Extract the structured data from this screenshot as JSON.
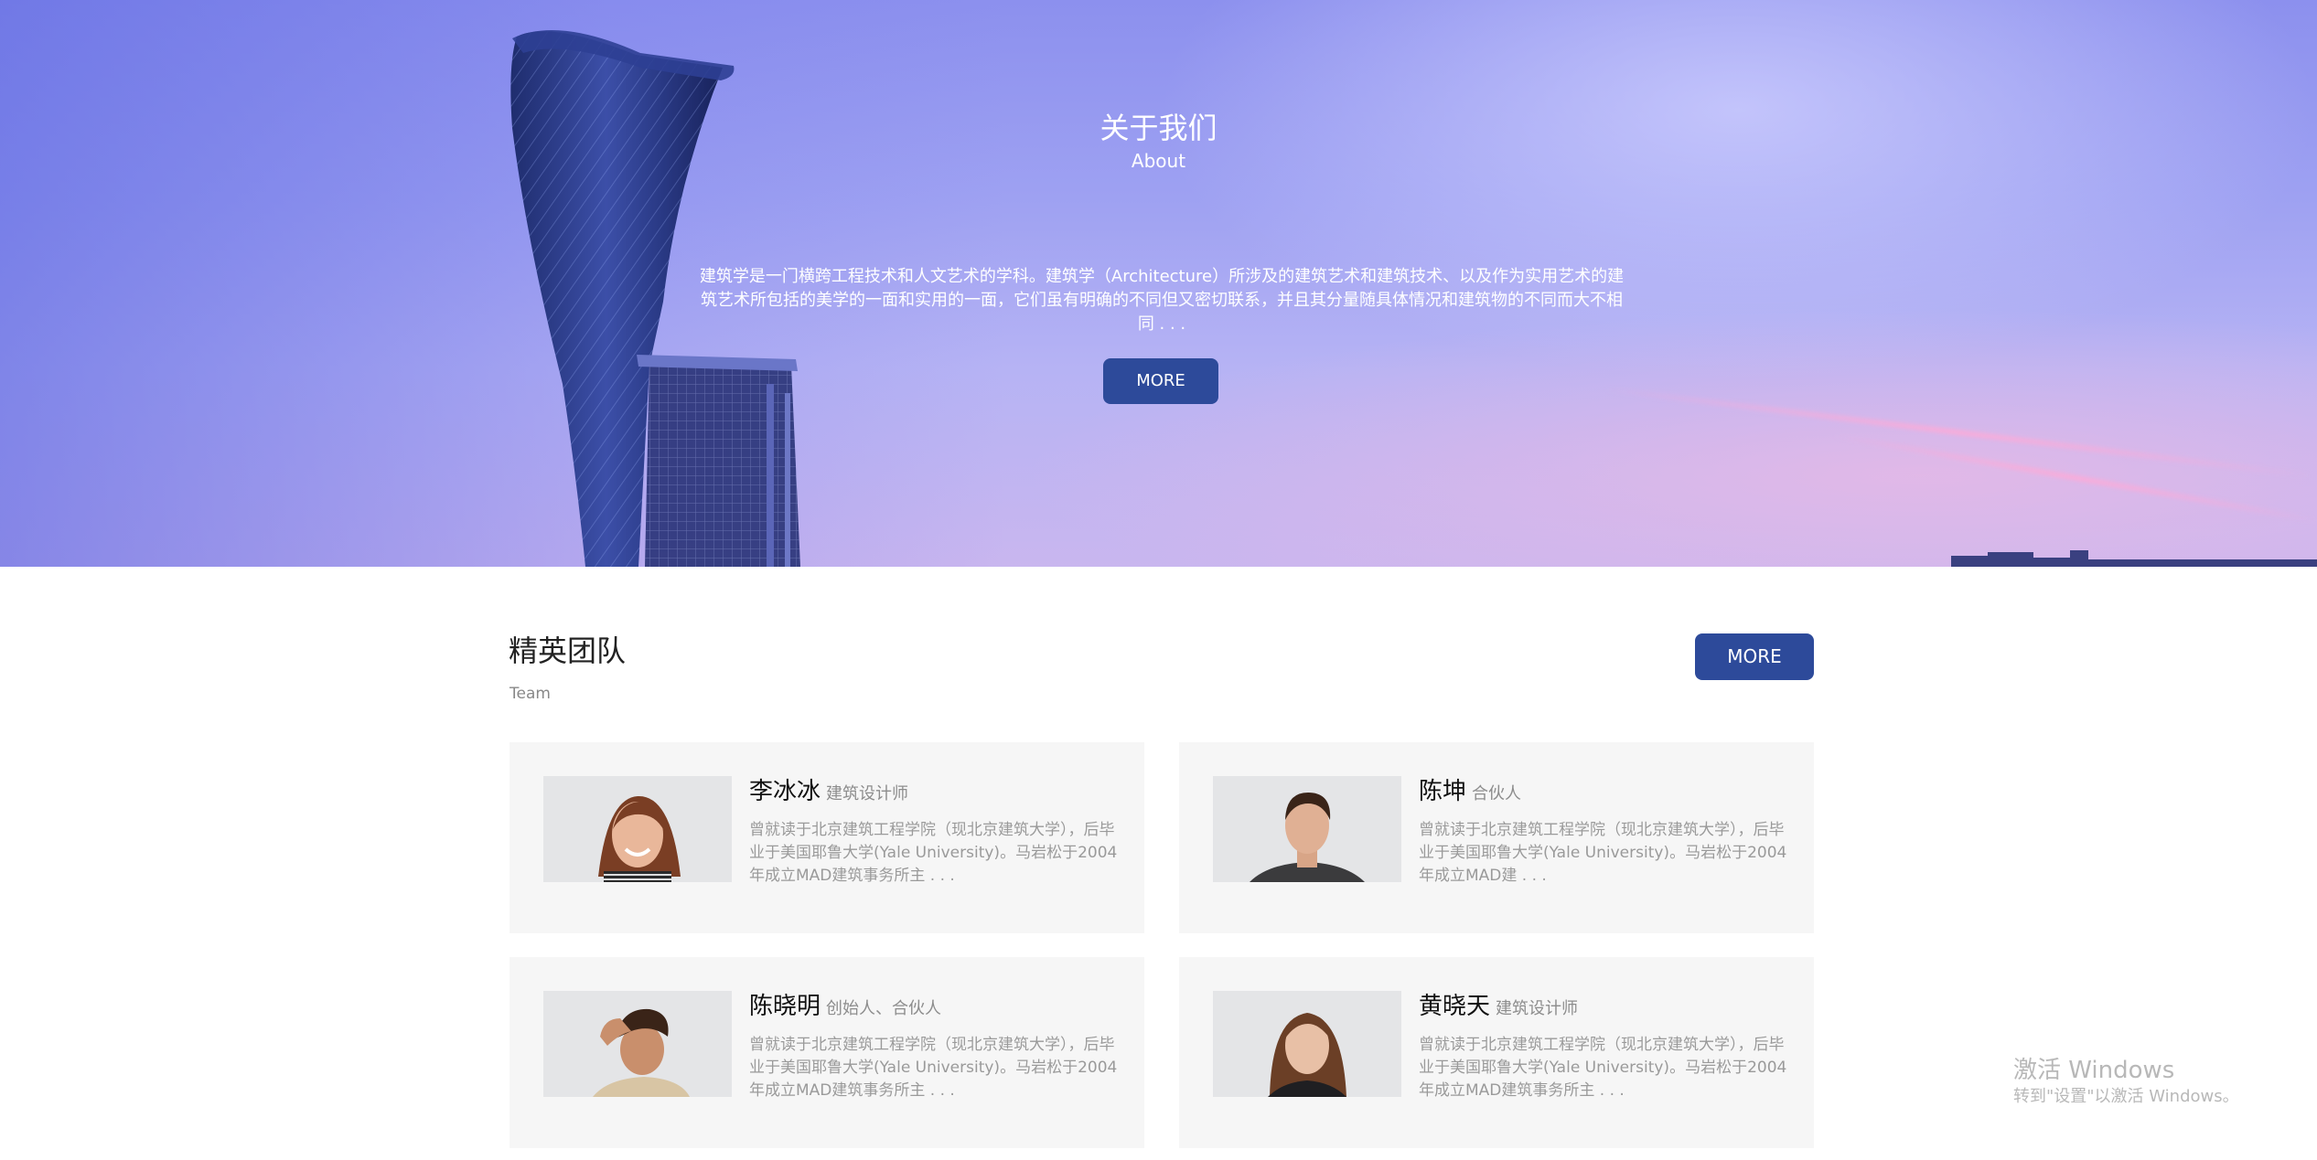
{
  "hero": {
    "title": "关于我们",
    "subtitle": "About",
    "description": "建筑学是一门横跨工程技术和人文艺术的学科。建筑学（Architecture）所涉及的建筑艺术和建筑技术、以及作为实用艺术的建筑艺术所包括的美学的一面和实用的一面，它们虽有明确的不同但又密切联系，并且其分量随具体情况和建筑物的不同而大不相同 . . .",
    "more_label": "MORE"
  },
  "team": {
    "title": "精英团队",
    "subtitle": "Team",
    "more_label": "MORE",
    "members": [
      {
        "name": "李冰冰",
        "role": "建筑设计师",
        "bio": "曾就读于北京建筑工程学院（现北京建筑大学），后毕业于美国耶鲁大学(Yale University)。马岩松于2004年成立MAD建筑事务所主 . . ."
      },
      {
        "name": "陈坤",
        "role": "合伙人",
        "bio": "曾就读于北京建筑工程学院（现北京建筑大学），后毕业于美国耶鲁大学(Yale University)。马岩松于2004年成立MAD建 . . ."
      },
      {
        "name": "陈晓明",
        "role": "创始人、合伙人",
        "bio": "曾就读于北京建筑工程学院（现北京建筑大学），后毕业于美国耶鲁大学(Yale University)。马岩松于2004年成立MAD建筑事务所主 . . ."
      },
      {
        "name": "黄晓天",
        "role": "建筑设计师",
        "bio": "曾就读于北京建筑工程学院（现北京建筑大学），后毕业于美国耶鲁大学(Yale University)。马岩松于2004年成立MAD建筑事务所主 . . ."
      }
    ]
  },
  "watermark": {
    "title": "激活 Windows",
    "subtitle": "转到\"设置\"以激活 Windows。"
  },
  "colors": {
    "accent": "#2d4a9a",
    "card_bg": "#f6f6f6",
    "muted_text": "#9a9a9a"
  }
}
